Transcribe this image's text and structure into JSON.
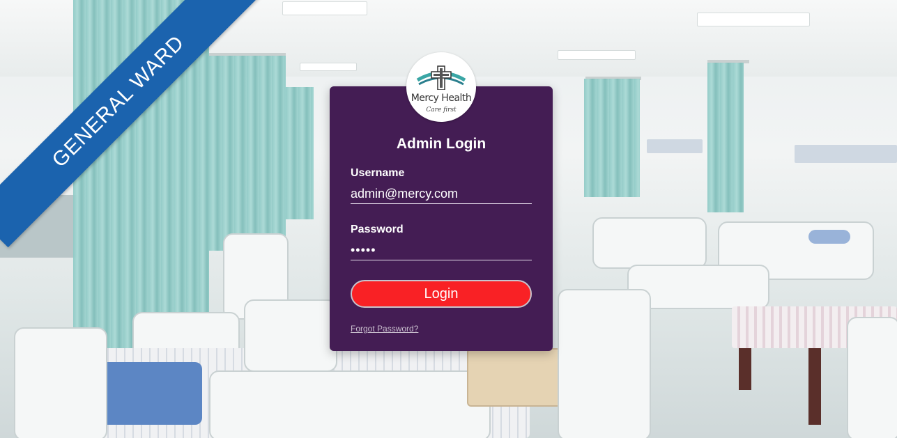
{
  "banner": {
    "text": "GENERAL WARD",
    "color": "#1b63ae"
  },
  "logo": {
    "name": "Mercy Health",
    "tagline": "Care first"
  },
  "login": {
    "title": "Admin Login",
    "username_label": "Username",
    "username_value": "admin@mercy.com",
    "password_label": "Password",
    "password_value": "•••••",
    "button_label": "Login",
    "forgot_link": "Forgot Password?"
  },
  "colors": {
    "card": "#441d54",
    "button": "#f92125",
    "banner": "#1b63ae"
  }
}
